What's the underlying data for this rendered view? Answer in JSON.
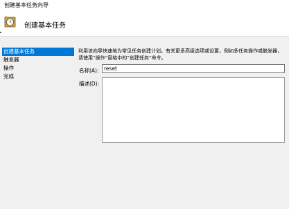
{
  "window": {
    "title": "创建基本任务向导"
  },
  "header": {
    "title": "创建基本任务",
    "icon": "scheduled-task-clock-icon"
  },
  "nav": {
    "items": [
      {
        "label": "创建基本任务",
        "selected": true
      },
      {
        "label": "触发器",
        "selected": false
      },
      {
        "label": "操作",
        "selected": false
      },
      {
        "label": "完成",
        "selected": false
      }
    ]
  },
  "main": {
    "description": "利用该向导快速地为常见任务创建计划。有关更多高级选项或设置，例如多任务操作或触发器，请使用“操作”窗格中的“创建任务”命令。",
    "name_label": "名称(A):",
    "name_value": "reset",
    "desc_label": "描述(D):",
    "desc_value": ""
  },
  "colors": {
    "selection": "#0078d7",
    "background": "#f0f0f0"
  }
}
